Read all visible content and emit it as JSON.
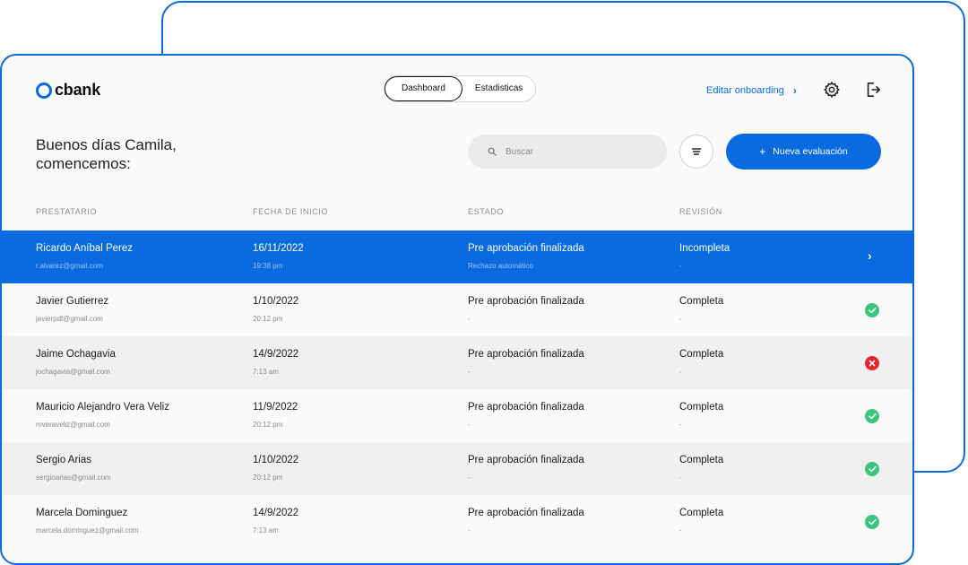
{
  "app": {
    "logo_text": "cbank"
  },
  "nav": {
    "tabs": [
      {
        "label": "Dashboard",
        "active": true
      },
      {
        "label": "Estadisticas",
        "active": false
      }
    ],
    "edit_link": "Editar onboarding"
  },
  "greeting": "Buenos días Camila,\ncomencemos:",
  "search": {
    "placeholder": "Buscar"
  },
  "new_button": {
    "label": "Nueva evaluación"
  },
  "table": {
    "headers": [
      "PRESTATARIO",
      "FECHA DE INICIO",
      "ESTADO",
      "REVISIÓN"
    ],
    "rows": [
      {
        "name": "Ricardo Aníbal Perez",
        "email": "r.alvarez@gmail.com",
        "date": "16/11/2022",
        "time": "19:38 pm",
        "estado": "Pre aprobación finalizada",
        "estado_sub": "Rechazo automático",
        "revision": "Incompleta",
        "revision_sub": "-",
        "indicator": "chevron"
      },
      {
        "name": "Javier Gutierrez",
        "email": "javierpdf@gmail.com",
        "date": "1/10/2022",
        "time": "20:12 pm",
        "estado": "Pre aprobación finalizada",
        "estado_sub": "-",
        "revision": "Completa",
        "revision_sub": "-",
        "indicator": "check"
      },
      {
        "name": "Jaime Ochagavia",
        "email": "jochagavia@gmail.com",
        "date": "14/9/2022",
        "time": "7:13 am",
        "estado": "Pre aprobación finalizada",
        "estado_sub": "-",
        "revision": "Completa",
        "revision_sub": "-",
        "indicator": "error"
      },
      {
        "name": "Mauricio Alejandro Vera Veliz",
        "email": "mveraveliz@gmail.com",
        "date": "11/9/2022",
        "time": "20:12 pm",
        "estado": "Pre aprobación finalizada",
        "estado_sub": "-",
        "revision": "Completa",
        "revision_sub": "-",
        "indicator": "check"
      },
      {
        "name": "Sergio Arias",
        "email": "sergioarias@gmail.com",
        "date": "1/10/2022",
        "time": "20:12 pm",
        "estado": "Pre aprobación finalizada",
        "estado_sub": "-",
        "revision": "Completa",
        "revision_sub": "-",
        "indicator": "check"
      },
      {
        "name": "Marcela Dominguez",
        "email": "marcela.dominguez@gmail.com",
        "date": "14/9/2022",
        "time": "7:13 am",
        "estado": "Pre aprobación finalizada",
        "estado_sub": "-",
        "revision": "Completa",
        "revision_sub": "-",
        "indicator": "check"
      }
    ]
  },
  "colors": {
    "accent": "#0a6be0",
    "success": "#3ac47d",
    "error": "#e5242b"
  },
  "icons": {
    "settings": "gear-icon",
    "logout": "logout-icon",
    "search": "search-icon",
    "filter": "filter-icon"
  }
}
